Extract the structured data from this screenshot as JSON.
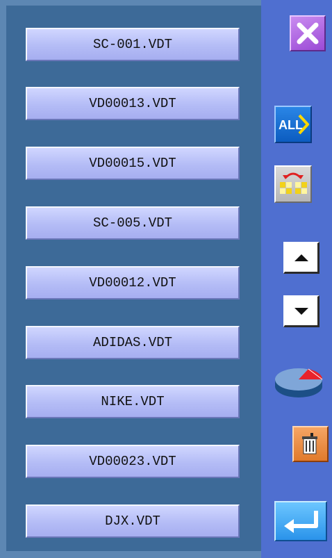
{
  "files": [
    {
      "name": "SC-001.VDT"
    },
    {
      "name": "VD00013.VDT"
    },
    {
      "name": "VD00015.VDT"
    },
    {
      "name": "SC-005.VDT"
    },
    {
      "name": "VD00012.VDT"
    },
    {
      "name": "ADIDAS.VDT"
    },
    {
      "name": "NIKE.VDT"
    },
    {
      "name": "VD00023.VDT"
    },
    {
      "name": "DJX.VDT"
    }
  ],
  "toolbar": {
    "close_icon": "close-x-icon",
    "all_label": "ALL",
    "swap_icon": "swap-grid-icon",
    "up_icon": "arrow-up-icon",
    "down_icon": "arrow-down-icon",
    "usage_icon": "pie-chart-icon",
    "delete_icon": "trash-can-icon",
    "enter_icon": "enter-return-icon"
  },
  "colors": {
    "panel_bg": "#3d6a98",
    "toolbar_bg": "#4f6fd0",
    "file_button": "#b4bcf6",
    "close_button": "#9b4ad6",
    "all_button": "#0c5cc0",
    "delete_button": "#e07a2c",
    "enter_button": "#2a93ea"
  }
}
